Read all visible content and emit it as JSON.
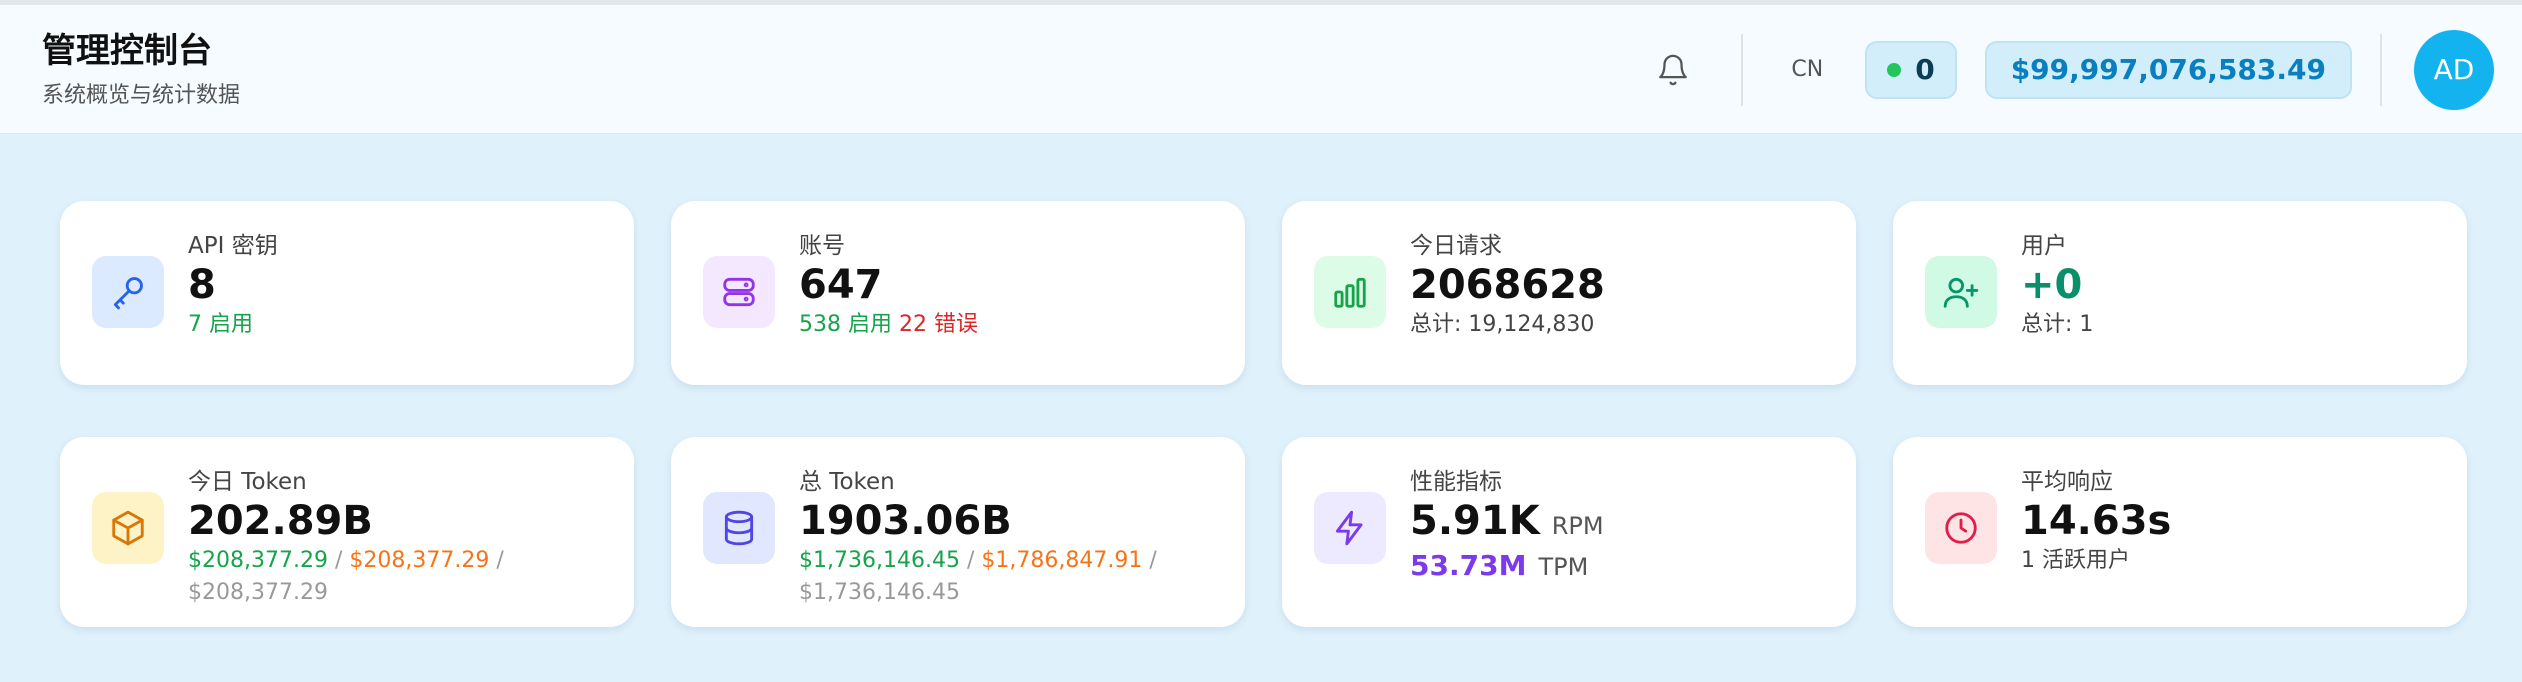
{
  "header": {
    "title": "管理控制台",
    "subtitle": "系统概览与统计数据",
    "language": "CN",
    "status_count": "0",
    "balance": "$99,997,076,583.49",
    "avatar_initials": "AD"
  },
  "cards": [
    {
      "label": "API 密钥",
      "value": "8",
      "sub1": "7 启用"
    },
    {
      "label": "账号",
      "value": "647",
      "sub1": "538 启用",
      "sub2": "22 错误"
    },
    {
      "label": "今日请求",
      "value": "2068628",
      "sub1": "总计: 19,124,830"
    },
    {
      "label": "用户",
      "value": "+0",
      "sub1": "总计: 1"
    },
    {
      "label": "今日 Token",
      "value": "202.89B",
      "sub1": "$208,377.29",
      "sub2": "$208,377.29",
      "sub3": "$208,377.29"
    },
    {
      "label": "总 Token",
      "value": "1903.06B",
      "sub1": "$1,736,146.45",
      "sub2": "$1,786,847.91",
      "sub3": "$1,736,146.45"
    },
    {
      "label": "性能指标",
      "value": "5.91K",
      "unit1": "RPM",
      "value2": "53.73M",
      "unit2": "TPM"
    },
    {
      "label": "平均响应",
      "value": "14.63s",
      "sub1": "1 活跃用户"
    }
  ],
  "icons": {
    "bell": "bell-icon",
    "key": "key-icon",
    "server": "server-icon",
    "chart": "bar-chart-icon",
    "user_plus": "user-plus-icon",
    "cube": "cube-icon",
    "database": "database-icon",
    "bolt": "bolt-icon",
    "clock": "clock-icon"
  },
  "colors": {
    "accent": "#13b3f0",
    "enabled": "#16a34a",
    "error": "#dc2626",
    "cost": "#f97316",
    "tpm": "#7c3aed"
  }
}
